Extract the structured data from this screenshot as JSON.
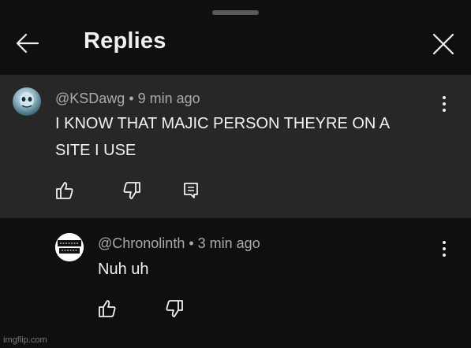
{
  "header": {
    "title": "Replies"
  },
  "parent_comment": {
    "author": "@KSDawg",
    "separator": "•",
    "time": "9 min ago",
    "text_line1": "I KNOW THAT MAJIC PERSON THEYRE ON A",
    "text_line2": "SITE I USE"
  },
  "reply": {
    "author": "@Chronolinth",
    "separator": "•",
    "time": "3 min ago",
    "text": "Nuh uh"
  },
  "watermark": "imgflip.com",
  "colors": {
    "background": "#0f0f0f",
    "highlight_background": "#272727",
    "primary_text": "#f1f1f1",
    "secondary_text": "#aaaaaa"
  },
  "icons": {
    "back": "arrow-left-icon",
    "close": "close-icon",
    "like": "thumbs-up-icon",
    "dislike": "thumbs-down-icon",
    "reply": "comment-reply-icon",
    "more": "more-vertical-icon"
  }
}
